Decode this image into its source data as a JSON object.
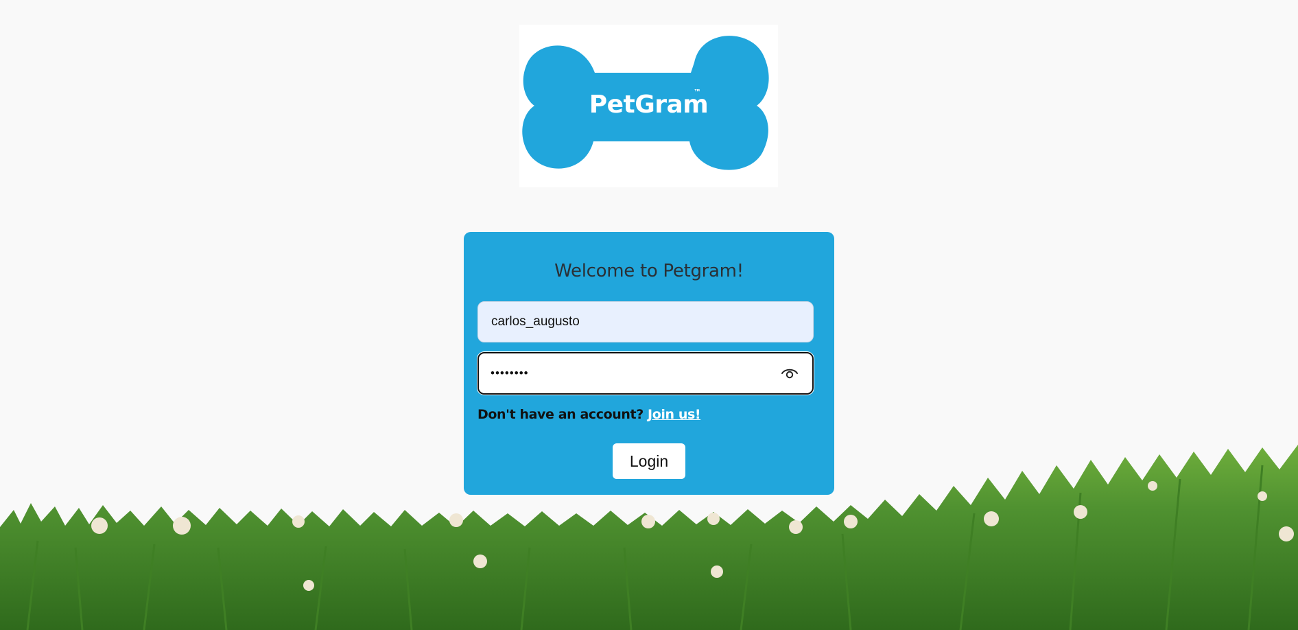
{
  "logo": {
    "text": "PetGram",
    "trademark": "™",
    "bone_color": "#21a6dc"
  },
  "login_card": {
    "title": "Welcome to Petgram!",
    "background_color": "#21a6dc",
    "username": {
      "value": "carlos_augusto"
    },
    "password": {
      "value": "password",
      "visibility_icon": "eye-icon"
    },
    "signup_prompt": "Don't have an account?",
    "signup_link": "Join us!",
    "login_button": "Login"
  },
  "background": {
    "grass_color": "#4a8a2a"
  }
}
